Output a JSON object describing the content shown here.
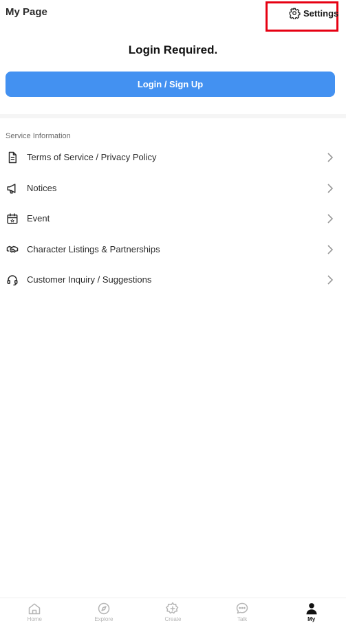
{
  "header": {
    "title": "My Page",
    "settings_label": "Settings",
    "settings_icon": "gear-icon",
    "highlight_color": "#e60012"
  },
  "login": {
    "title": "Login Required.",
    "button_label": "Login / Sign Up",
    "button_color": "#4391f1"
  },
  "service": {
    "section_title": "Service Information",
    "items": [
      {
        "label": "Terms of Service / Privacy Policy",
        "icon": "document-icon"
      },
      {
        "label": "Notices",
        "icon": "megaphone-icon"
      },
      {
        "label": "Event",
        "icon": "calendar-icon"
      },
      {
        "label": "Character Listings & Partnerships",
        "icon": "handshake-icon"
      },
      {
        "label": "Customer Inquiry / Suggestions",
        "icon": "headset-icon"
      }
    ]
  },
  "tabbar": {
    "tabs": [
      {
        "label": "Home",
        "icon": "home-icon",
        "active": false
      },
      {
        "label": "Explore",
        "icon": "compass-icon",
        "active": false
      },
      {
        "label": "Create",
        "icon": "create-icon",
        "active": false
      },
      {
        "label": "Talk",
        "icon": "chat-icon",
        "active": false
      },
      {
        "label": "My",
        "icon": "person-icon",
        "active": true
      }
    ]
  }
}
